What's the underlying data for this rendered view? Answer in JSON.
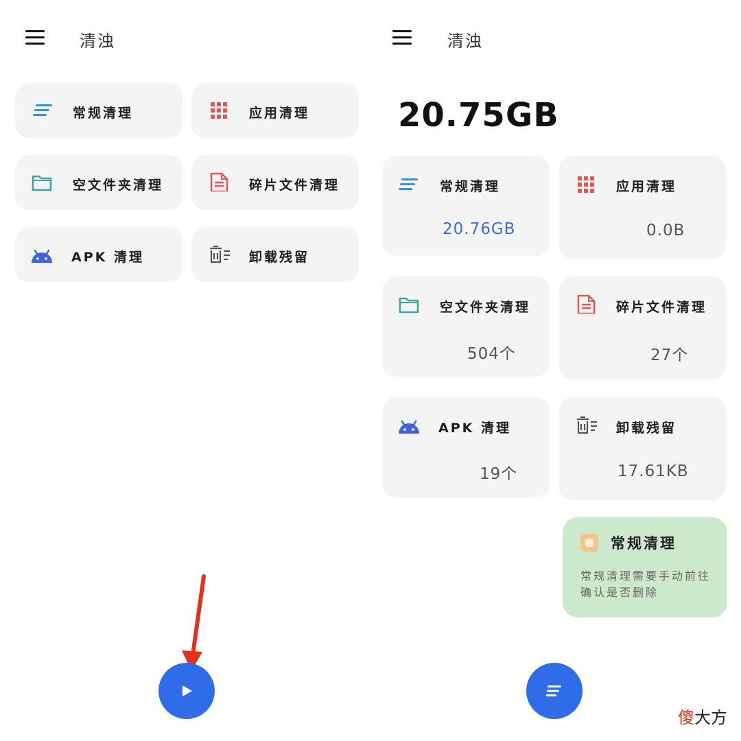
{
  "app": {
    "title": "清浊"
  },
  "left_screen": {
    "cards": [
      {
        "label": "常规清理",
        "icon": "lines-icon"
      },
      {
        "label": "应用清理",
        "icon": "grid-icon"
      },
      {
        "label": "空文件夹清理",
        "icon": "folder-icon"
      },
      {
        "label": "碎片文件清理",
        "icon": "document-icon"
      },
      {
        "label": "APK 清理",
        "icon": "android-icon"
      },
      {
        "label": "卸载残留",
        "icon": "uninstall-residue-icon"
      }
    ],
    "fab": {
      "icon": "play-icon"
    }
  },
  "right_screen": {
    "total_size": "20.75GB",
    "cards": [
      {
        "label": "常规清理",
        "value": "20.76GB",
        "icon": "lines-icon"
      },
      {
        "label": "应用清理",
        "value": "0.0B",
        "icon": "grid-icon"
      },
      {
        "label": "空文件夹清理",
        "value": "504个",
        "icon": "folder-icon"
      },
      {
        "label": "碎片文件清理",
        "value": "27个",
        "icon": "document-icon"
      },
      {
        "label": "APK 清理",
        "value": "19个",
        "icon": "android-icon"
      },
      {
        "label": "卸载残留",
        "value": "17.61KB",
        "icon": "uninstall-residue-icon"
      }
    ],
    "notice": {
      "title": "常规清理",
      "text": "常规清理需要手动前往确认是否删除"
    },
    "fab": {
      "icon": "lines-icon"
    }
  },
  "watermark": {
    "red_part": "傻",
    "black_part": "大方"
  },
  "colors": {
    "fab": "#2f6de8",
    "lines_icon": "#3a8fe0",
    "grid_icon": "#e0584f",
    "folder_icon": "#3aa59a",
    "document_icon": "#e0584f",
    "android_icon": "#3d63e0",
    "notice_bg": "#cde9cb",
    "highlight_value": "#3a6ee0",
    "arrow": "#e0331f"
  }
}
